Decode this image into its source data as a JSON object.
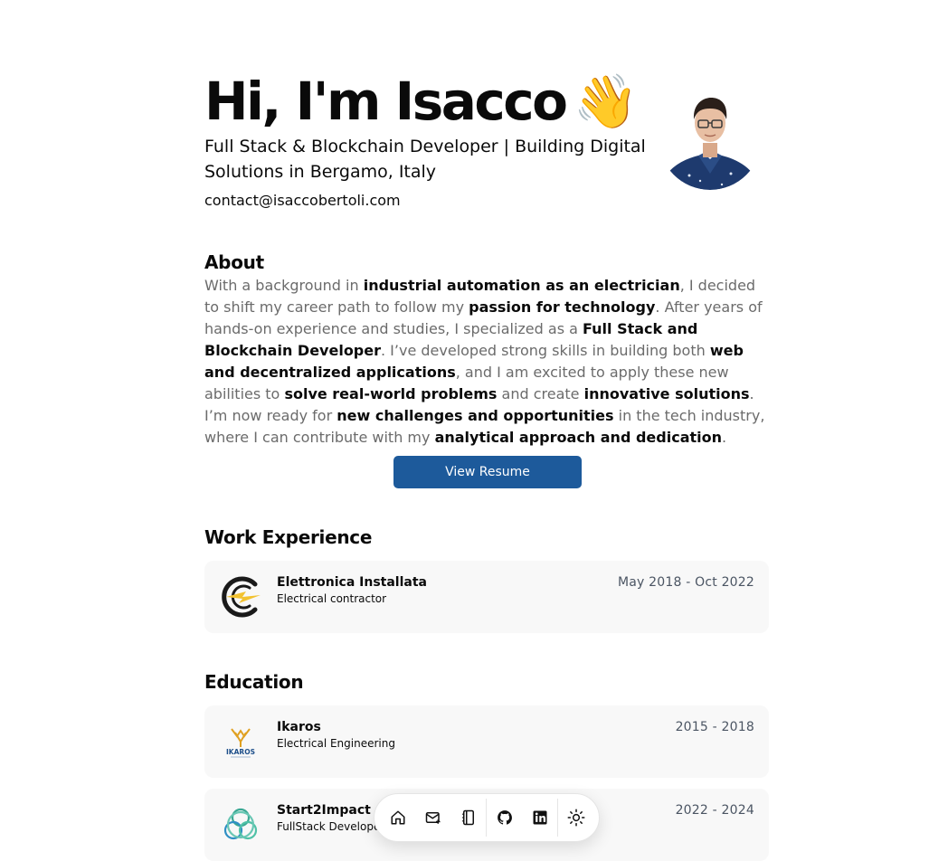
{
  "hero": {
    "title": "Hi, I'm Isacco",
    "wave_emoji": "👋",
    "subtitle": "Full Stack & Blockchain Developer | Building Digital Solutions in Bergamo, Italy",
    "email": "contact@isaccobertoli.com",
    "avatar_icon": "profile-photo"
  },
  "about": {
    "title": "About",
    "segments": [
      "With a background in ",
      "industrial automation as an electrician",
      ", I decided to shift my career path to follow my ",
      "passion for technology",
      ". After years of hands-on experience and studies, I specialized as a ",
      "Full Stack and Blockchain Developer",
      ". I’ve developed strong skills in building both ",
      "web and decentralized applications",
      ", and I am excited to apply these new abilities to ",
      "solve real-world problems",
      " and create ",
      "innovative solutions",
      ". I’m now ready for ",
      "new challenges and opportunities",
      " in the tech industry, where I can contribute with my ",
      "analytical approach and dedication",
      "."
    ],
    "resume_button": "View Resume"
  },
  "work": {
    "title": "Work Experience",
    "items": [
      {
        "name": "Elettronica Installata",
        "role": "Electrical contractor",
        "date": "May 2018 - Oct 2022",
        "logo_icon": "lightning-c-logo"
      }
    ]
  },
  "education": {
    "title": "Education",
    "items": [
      {
        "name": "Ikaros",
        "role": "Electrical Engineering",
        "date": "2015 - 2018",
        "logo_icon": "ikaros-logo",
        "logo_text": "IKAROS"
      },
      {
        "name": "Start2Impact",
        "role": "FullStack Developer",
        "date": "2022 - 2024",
        "logo_icon": "start2impact-logo"
      }
    ]
  },
  "dock": {
    "items": [
      "home-icon",
      "mail-icon",
      "notebook-icon",
      "github-icon",
      "linkedin-icon",
      "sun-icon"
    ]
  },
  "colors": {
    "accent": "#1d5a9b",
    "muted_text": "#6b6b6b",
    "card_bg": "#f8f8f8"
  }
}
